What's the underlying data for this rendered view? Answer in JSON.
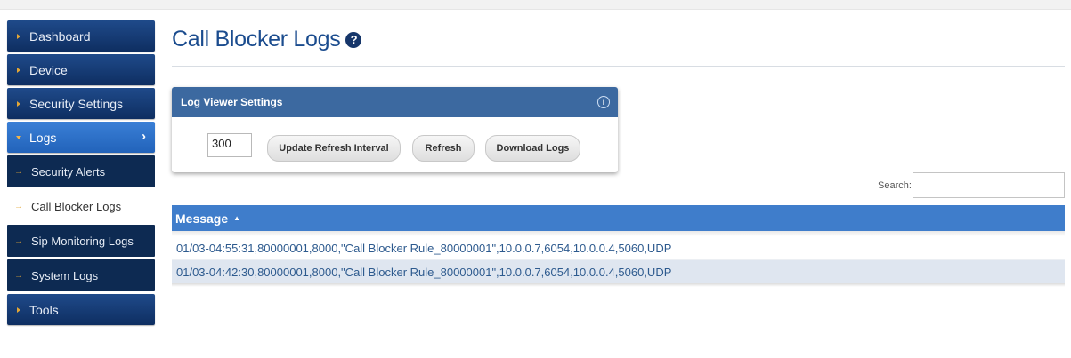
{
  "page": {
    "title": "Call Blocker Logs"
  },
  "sidebar": {
    "items": [
      {
        "label": "Dashboard"
      },
      {
        "label": "Device"
      },
      {
        "label": "Security Settings"
      },
      {
        "label": "Logs"
      }
    ],
    "subitems": [
      {
        "label": "Security Alerts"
      },
      {
        "label": "Call Blocker Logs"
      },
      {
        "label": "Sip Monitoring Logs"
      },
      {
        "label": "System Logs"
      }
    ],
    "tools": {
      "label": "Tools"
    }
  },
  "settings": {
    "header": "Log Viewer Settings",
    "refresh_interval": "300",
    "update_label": "Update Refresh Interval",
    "refresh_label": "Refresh",
    "download_label": "Download Logs"
  },
  "search": {
    "label": "Search:"
  },
  "table": {
    "column": "Message",
    "rows": [
      "01/03-04:55:31,80000001,8000,\"Call Blocker Rule_80000001\",10.0.0.7,6054,10.0.0.4,5060,UDP",
      "01/03-04:42:30,80000001,8000,\"Call Blocker Rule_80000001\",10.0.0.7,6054,10.0.0.4,5060,UDP"
    ]
  },
  "colors": {
    "nav": "#143b74",
    "accent": "#3f7dcb",
    "active": "#2f73c9",
    "title": "#1b4c8e"
  }
}
